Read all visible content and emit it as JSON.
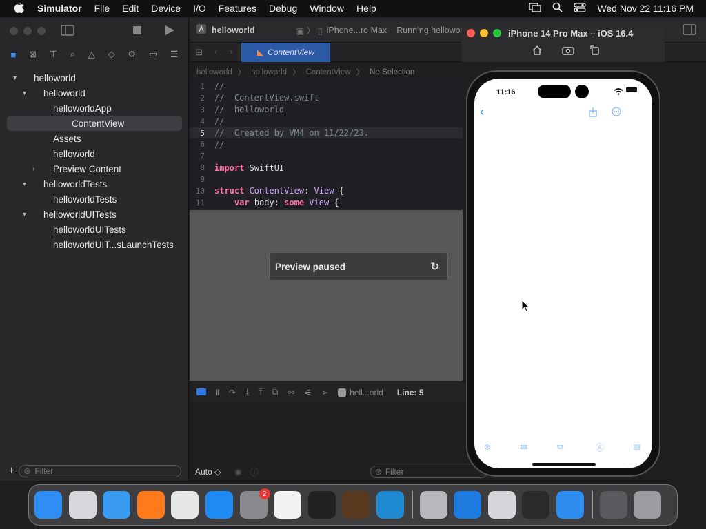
{
  "menubar": {
    "app_name": "Simulator",
    "items": [
      "File",
      "Edit",
      "Device",
      "I/O",
      "Features",
      "Debug",
      "Window",
      "Help"
    ],
    "datetime": "Wed Nov 22  11:16 PM"
  },
  "navigator": {
    "tree": [
      {
        "label": "helloworld",
        "level": 0,
        "disclosure": "▾"
      },
      {
        "label": "helloworld",
        "level": 1,
        "disclosure": "▾"
      },
      {
        "label": "helloworldApp",
        "level": 2,
        "disclosure": ""
      },
      {
        "label": "ContentView",
        "level": 2,
        "disclosure": "",
        "selected": true
      },
      {
        "label": "Assets",
        "level": 2,
        "disclosure": ""
      },
      {
        "label": "helloworld",
        "level": 2,
        "disclosure": ""
      },
      {
        "label": "Preview Content",
        "level": 2,
        "disclosure": "›"
      },
      {
        "label": "helloworldTests",
        "level": 1,
        "disclosure": "▾"
      },
      {
        "label": "helloworldTests",
        "level": 2,
        "disclosure": ""
      },
      {
        "label": "helloworldUITests",
        "level": 1,
        "disclosure": "▾"
      },
      {
        "label": "helloworldUITests",
        "level": 2,
        "disclosure": ""
      },
      {
        "label": "helloworldUIT...sLaunchTests",
        "level": 2,
        "disclosure": ""
      }
    ],
    "filter_placeholder": "Filter"
  },
  "toolbar": {
    "project": "helloworld",
    "device": "iPhone...ro Max",
    "status": "Running hellowor"
  },
  "editor": {
    "tab_label": "ContentView",
    "jump_bar": [
      "helloworld",
      "helloworld",
      "ContentView",
      "No Selection"
    ],
    "code_lines": [
      {
        "n": "1",
        "parts": [
          {
            "c": "cm",
            "t": "//"
          }
        ]
      },
      {
        "n": "2",
        "parts": [
          {
            "c": "cm",
            "t": "//  ContentView.swift"
          }
        ]
      },
      {
        "n": "3",
        "parts": [
          {
            "c": "cm",
            "t": "//  helloworld"
          }
        ]
      },
      {
        "n": "4",
        "parts": [
          {
            "c": "cm",
            "t": "//"
          }
        ]
      },
      {
        "n": "5",
        "parts": [
          {
            "c": "cm",
            "t": "//  Created by VM4 on 11/22/23."
          }
        ],
        "current": true
      },
      {
        "n": "6",
        "parts": [
          {
            "c": "cm",
            "t": "//"
          }
        ]
      },
      {
        "n": "7",
        "parts": []
      },
      {
        "n": "8",
        "parts": [
          {
            "c": "kw",
            "t": "import"
          },
          {
            "c": "pl",
            "t": " SwiftUI"
          }
        ]
      },
      {
        "n": "9",
        "parts": []
      },
      {
        "n": "10",
        "parts": [
          {
            "c": "kw",
            "t": "struct"
          },
          {
            "c": "ty",
            "t": " ContentView"
          },
          {
            "c": "pl",
            "t": ": "
          },
          {
            "c": "ty",
            "t": "View"
          },
          {
            "c": "pl",
            "t": " {"
          }
        ]
      },
      {
        "n": "11",
        "parts": [
          {
            "c": "pl",
            "t": "    "
          },
          {
            "c": "kw",
            "t": "var"
          },
          {
            "c": "pl",
            "t": " body: "
          },
          {
            "c": "kw",
            "t": "some"
          },
          {
            "c": "ty",
            "t": " View"
          },
          {
            "c": "pl",
            "t": " {"
          }
        ]
      }
    ],
    "preview_status": "Preview paused"
  },
  "debug_bar": {
    "scheme": "hell...orld",
    "line": "Line: 5"
  },
  "bottom_bar": {
    "zoom": "Auto ◇",
    "filter_placeholder": "Filter"
  },
  "simulator": {
    "title": "iPhone 14 Pro Max – iOS 16.4",
    "time": "11:16"
  },
  "dock": {
    "apps": [
      {
        "name": "Finder",
        "color": "#2f8ef4"
      },
      {
        "name": "Launchpad",
        "color": "#d8d8dc"
      },
      {
        "name": "Safari",
        "color": "#3a9cf0"
      },
      {
        "name": "Firefox",
        "color": "#ff7a1a"
      },
      {
        "name": "Chrome",
        "color": "#e6e6e6"
      },
      {
        "name": "App Store",
        "color": "#1e8bf5"
      },
      {
        "name": "System Settings",
        "color": "#8a8a8e",
        "badge": "2"
      },
      {
        "name": "TextEdit",
        "color": "#f2f2f2"
      },
      {
        "name": "Terminal",
        "color": "#222"
      },
      {
        "name": "GarageBand",
        "color": "#5a3a1e"
      },
      {
        "name": "VS Code",
        "color": "#1f8ad2"
      },
      {
        "name": "Installer",
        "color": "#b8b8bc"
      },
      {
        "name": "Xcode",
        "color": "#1e7be0"
      },
      {
        "name": "Preview",
        "color": "#d6d6da"
      },
      {
        "name": "Activity Monitor",
        "color": "#2a2a2c"
      },
      {
        "name": "Simulator",
        "color": "#2d8cf0"
      },
      {
        "name": "Downloads",
        "color": "#5a5a5e"
      },
      {
        "name": "Trash",
        "color": "#9c9ca0"
      }
    ]
  }
}
